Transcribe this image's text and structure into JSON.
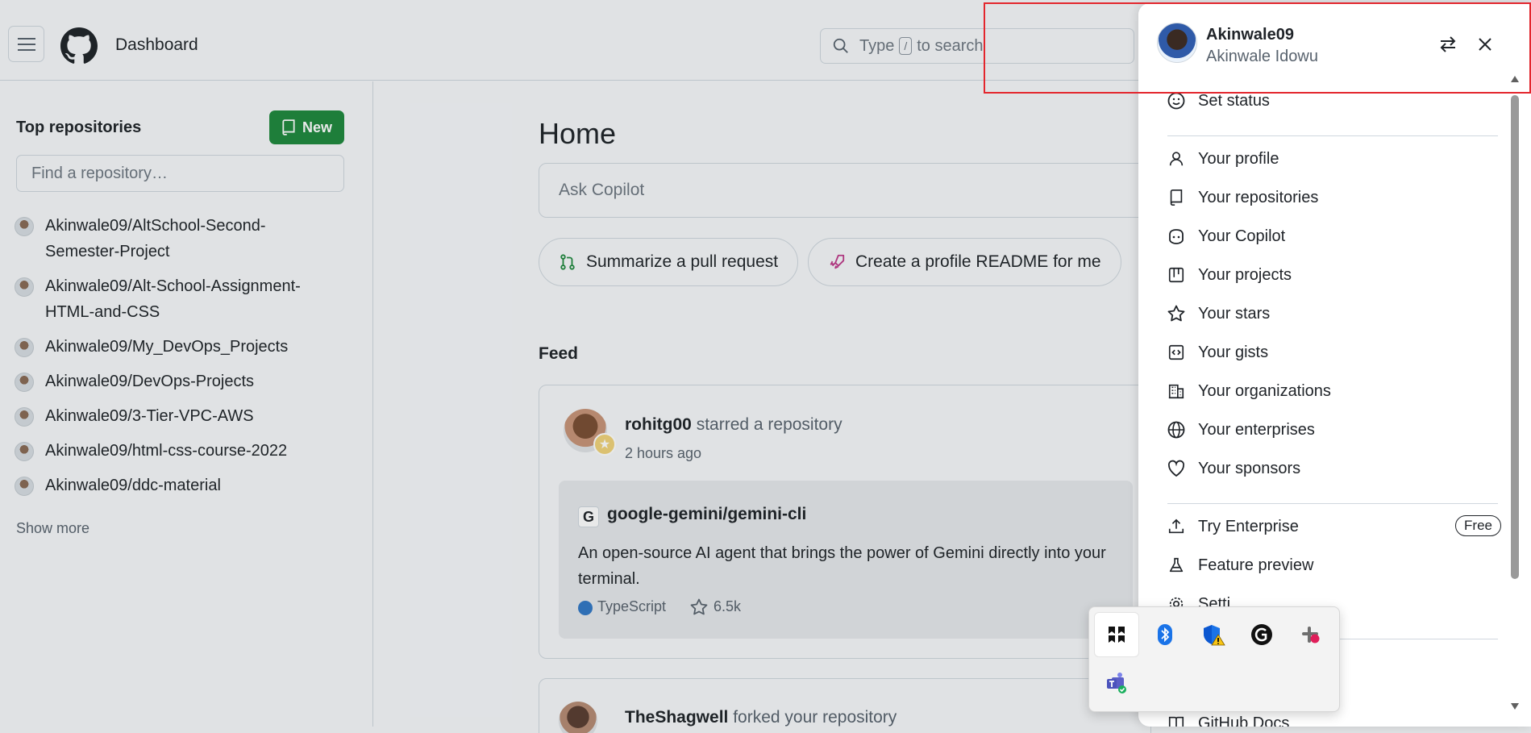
{
  "header": {
    "title": "Dashboard",
    "search_prefix": "Type",
    "search_key": "/",
    "search_suffix": "to search"
  },
  "sidebar": {
    "heading": "Top repositories",
    "new_label": "New",
    "find_placeholder": "Find a repository…",
    "repos": [
      {
        "line1": "Akinwale09/AltSchool-Second-",
        "line2": "Semester-Project"
      },
      {
        "line1": "Akinwale09/Alt-School-Assignment-",
        "line2": "HTML-and-CSS"
      },
      {
        "line1": "Akinwale09/My_DevOps_Projects",
        "line2": ""
      },
      {
        "line1": "Akinwale09/DevOps-Projects",
        "line2": ""
      },
      {
        "line1": "Akinwale09/3-Tier-VPC-AWS",
        "line2": ""
      },
      {
        "line1": "Akinwale09/html-css-course-2022",
        "line2": ""
      },
      {
        "line1": "Akinwale09/ddc-material",
        "line2": ""
      }
    ],
    "show_more": "Show more"
  },
  "main": {
    "title": "Home",
    "copilot_placeholder": "Ask Copilot",
    "suggestions": [
      "Summarize a pull request",
      "Create a profile README for me"
    ],
    "feed_title": "Feed",
    "feed": [
      {
        "user": "rohitg00",
        "action": "starred a repository",
        "time": "2 hours ago",
        "repo_logo": "G",
        "repo_name": "google-gemini/gemini-cli",
        "repo_desc_line1": "An open-source AI agent that brings the power of Gemini directly into your",
        "repo_desc_line2": "terminal.",
        "language": "TypeScript",
        "language_color": "#3178c6",
        "stars": "6.5k"
      },
      {
        "user": "TheShagwell",
        "action": "forked your repository"
      }
    ]
  },
  "user_menu": {
    "username": "Akinwale09",
    "full_name": "Akinwale Idowu",
    "items": [
      {
        "label": "Set status",
        "icon": "smiley-icon"
      },
      {
        "label": "Your profile",
        "icon": "person-icon"
      },
      {
        "label": "Your repositories",
        "icon": "repo-icon"
      },
      {
        "label": "Your Copilot",
        "icon": "copilot-icon"
      },
      {
        "label": "Your projects",
        "icon": "project-icon"
      },
      {
        "label": "Your stars",
        "icon": "star-icon"
      },
      {
        "label": "Your gists",
        "icon": "code-square-icon"
      },
      {
        "label": "Your organizations",
        "icon": "organization-icon"
      },
      {
        "label": "Your enterprises",
        "icon": "globe-icon"
      },
      {
        "label": "Your sponsors",
        "icon": "heart-icon"
      },
      {
        "label": "Try Enterprise",
        "icon": "upload-icon"
      },
      {
        "label": "Feature preview",
        "icon": "beaker-icon"
      },
      {
        "label": "Setti",
        "icon": "gear-icon"
      },
      {
        "label": "GitHub Docs",
        "icon": "book-icon"
      }
    ],
    "free_badge": "Free"
  },
  "tray": {
    "icons": [
      "app-icon",
      "bluetooth-icon",
      "defender-warning-icon",
      "grammarly-icon",
      "slack-icon",
      "teams-icon"
    ]
  },
  "colors": {
    "accent_green": "#1f883d",
    "highlight_red": "#e3262d"
  }
}
